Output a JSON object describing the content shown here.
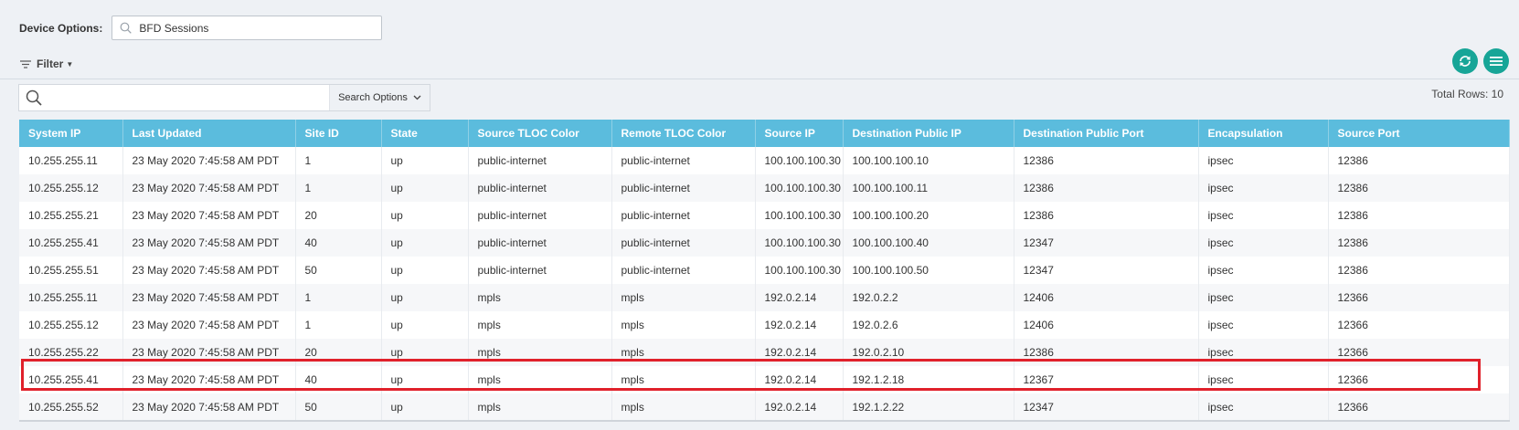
{
  "device_options": {
    "label": "Device Options:",
    "selected": "BFD Sessions"
  },
  "filter": {
    "label": "Filter"
  },
  "search": {
    "placeholder": "",
    "options_label": "Search Options"
  },
  "total_rows": "Total Rows: 10",
  "table": {
    "columns": [
      "System IP",
      "Last Updated",
      "Site ID",
      "State",
      "Source TLOC Color",
      "Remote TLOC Color",
      "Source IP",
      "Destination Public IP",
      "Destination Public Port",
      "Encapsulation",
      "Source Port"
    ],
    "rows": [
      [
        "10.255.255.11",
        "23 May 2020 7:45:58 AM PDT",
        "1",
        "up",
        "public-internet",
        "public-internet",
        "100.100.100.30",
        "100.100.100.10",
        "12386",
        "ipsec",
        "12386"
      ],
      [
        "10.255.255.12",
        "23 May 2020 7:45:58 AM PDT",
        "1",
        "up",
        "public-internet",
        "public-internet",
        "100.100.100.30",
        "100.100.100.11",
        "12386",
        "ipsec",
        "12386"
      ],
      [
        "10.255.255.21",
        "23 May 2020 7:45:58 AM PDT",
        "20",
        "up",
        "public-internet",
        "public-internet",
        "100.100.100.30",
        "100.100.100.20",
        "12386",
        "ipsec",
        "12386"
      ],
      [
        "10.255.255.41",
        "23 May 2020 7:45:58 AM PDT",
        "40",
        "up",
        "public-internet",
        "public-internet",
        "100.100.100.30",
        "100.100.100.40",
        "12347",
        "ipsec",
        "12386"
      ],
      [
        "10.255.255.51",
        "23 May 2020 7:45:58 AM PDT",
        "50",
        "up",
        "public-internet",
        "public-internet",
        "100.100.100.30",
        "100.100.100.50",
        "12347",
        "ipsec",
        "12386"
      ],
      [
        "10.255.255.11",
        "23 May 2020 7:45:58 AM PDT",
        "1",
        "up",
        "mpls",
        "mpls",
        "192.0.2.14",
        "192.0.2.2",
        "12406",
        "ipsec",
        "12366"
      ],
      [
        "10.255.255.12",
        "23 May 2020 7:45:58 AM PDT",
        "1",
        "up",
        "mpls",
        "mpls",
        "192.0.2.14",
        "192.0.2.6",
        "12406",
        "ipsec",
        "12366"
      ],
      [
        "10.255.255.22",
        "23 May 2020 7:45:58 AM PDT",
        "20",
        "up",
        "mpls",
        "mpls",
        "192.0.2.14",
        "192.0.2.10",
        "12386",
        "ipsec",
        "12366"
      ],
      [
        "10.255.255.41",
        "23 May 2020 7:45:58 AM PDT",
        "40",
        "up",
        "mpls",
        "mpls",
        "192.0.2.14",
        "192.1.2.18",
        "12367",
        "ipsec",
        "12366"
      ],
      [
        "10.255.255.52",
        "23 May 2020 7:45:58 AM PDT",
        "50",
        "up",
        "mpls",
        "mpls",
        "192.0.2.14",
        "192.1.2.22",
        "12347",
        "ipsec",
        "12366"
      ]
    ]
  },
  "colors": {
    "header_bg": "#5bbcdd",
    "action_button": "#17a597",
    "highlight": "#e0212b"
  },
  "icons": {
    "device_search": "search-icon",
    "filter": "filter-icon",
    "refresh": "refresh-icon",
    "menu": "menu-icon",
    "table_search": "search-icon",
    "options": "chevron-down-icon"
  }
}
